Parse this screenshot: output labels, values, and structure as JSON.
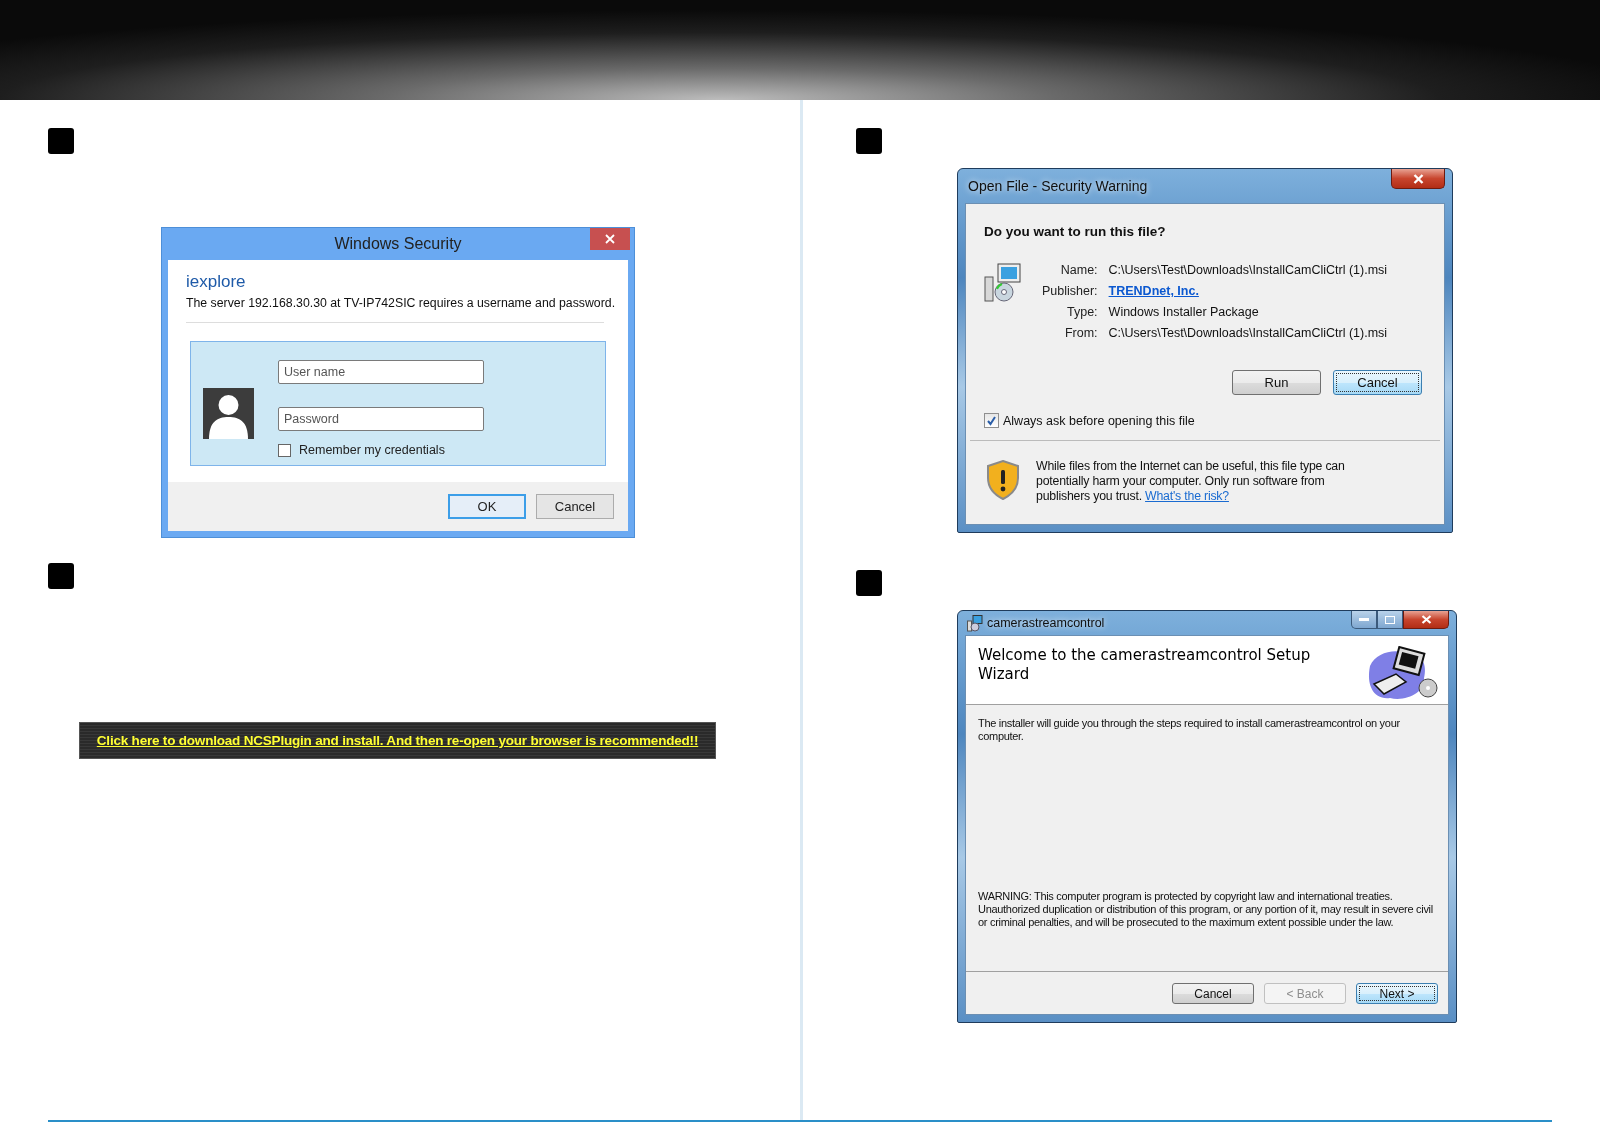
{
  "login_dialog": {
    "title": "Windows Security",
    "app_name": "iexplore",
    "message": "The server 192.168.30.30 at TV-IP742SIC requires a username and password.",
    "username": {
      "placeholder": "User name"
    },
    "password": {
      "placeholder": "Password"
    },
    "remember": {
      "label": "Remember my credentials",
      "checked": false
    },
    "buttons": [
      {
        "label": "OK",
        "default": true
      },
      {
        "label": "Cancel",
        "default": false
      }
    ]
  },
  "plugin_banner": {
    "link": "Click here to download NCSPlugin and install. And then re-open your browser is recommended!!"
  },
  "security_warning": {
    "title": "Open File - Security Warning",
    "question": "Do you want to run this file?",
    "fields": [
      {
        "label": "Name:",
        "value": "C:\\Users\\Test\\Downloads\\InstallCamCliCtrl (1).msi",
        "kind": "text"
      },
      {
        "label": "Publisher:",
        "value": "TRENDnet, Inc.",
        "kind": "link"
      },
      {
        "label": "Type:",
        "value": "Windows Installer Package",
        "kind": "text"
      },
      {
        "label": "From:",
        "value": "C:\\Users\\Test\\Downloads\\InstallCamCliCtrl (1).msi",
        "kind": "text"
      }
    ],
    "buttons": [
      {
        "label": "Run",
        "default": false
      },
      {
        "label": "Cancel",
        "default": true
      }
    ],
    "always_ask": {
      "label": "Always ask before opening this file",
      "checked": true
    },
    "notice": "While files from the Internet can be useful, this file type can potentially harm your computer. Only run software from publishers you trust.",
    "risk_link": "What's the risk?"
  },
  "setup_wizard": {
    "title": "camerastreamcontrol",
    "heading": "Welcome to the camerastreamcontrol Setup Wizard",
    "intro": "The installer will guide you through the steps required to install camerastreamcontrol on your computer.",
    "warning": "WARNING: This computer program is protected by copyright law and international treaties. Unauthorized duplication or distribution of this program, or any portion of it, may result in severe civil or criminal penalties, and will be prosecuted to the maximum extent possible under the law.",
    "buttons": [
      {
        "label": "Cancel",
        "disabled": false,
        "default": false
      },
      {
        "label": "< Back",
        "disabled": true,
        "default": false
      },
      {
        "label": "Next >",
        "disabled": false,
        "default": true
      }
    ]
  }
}
